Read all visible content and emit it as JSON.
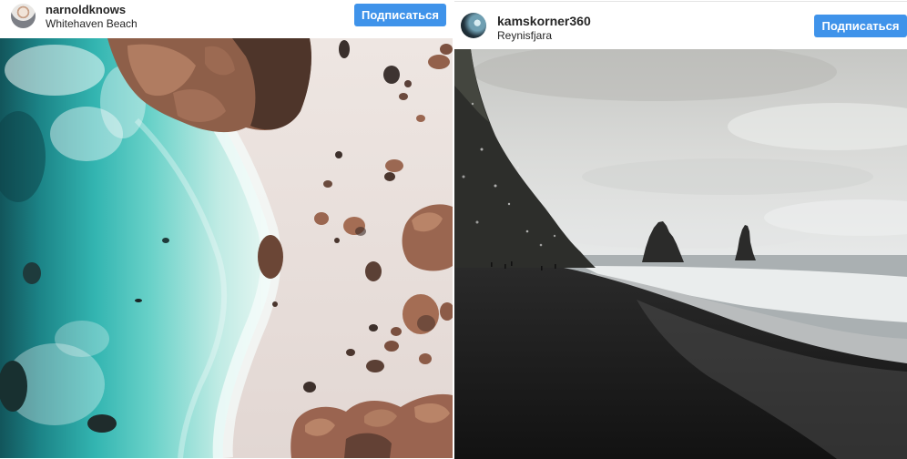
{
  "posts": [
    {
      "username": "narnoldknows",
      "location": "Whitehaven Beach",
      "follow_label": "Подписаться"
    },
    {
      "username": "kamskorner360",
      "location": "Reynisfjara",
      "follow_label": "Подписаться"
    }
  ],
  "colors": {
    "follow_button": "#3f93ea",
    "text": "#262626",
    "background": "#ffffff"
  },
  "icons": {
    "avatar": "user-avatar"
  }
}
